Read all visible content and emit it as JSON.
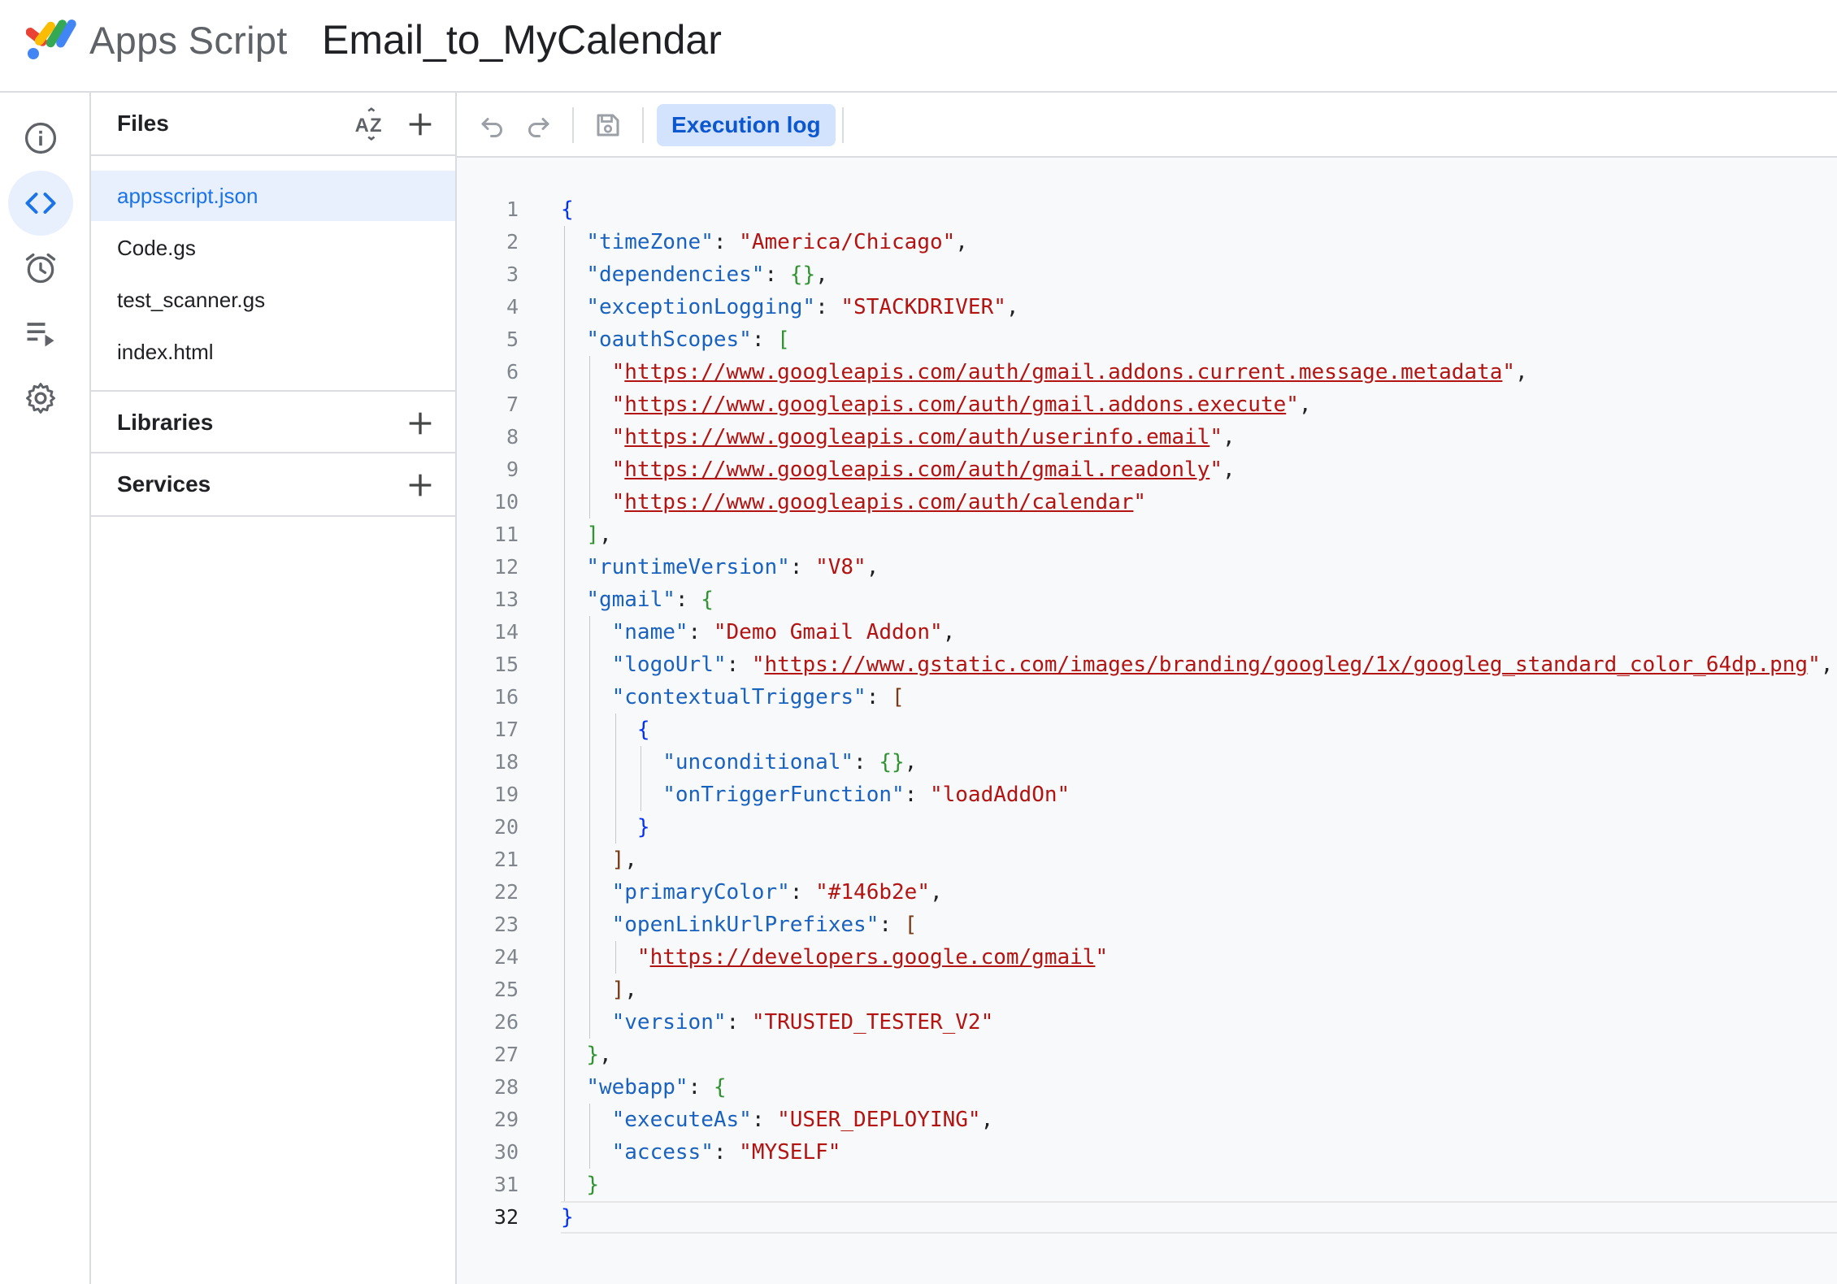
{
  "header": {
    "product_name": "Apps Script",
    "project_title": "Email_to_MyCalendar",
    "logo_icon": "apps-script-logo-icon"
  },
  "rail": {
    "items": [
      {
        "name": "overview",
        "icon": "info-icon",
        "active": false
      },
      {
        "name": "editor",
        "icon": "code-brackets-icon",
        "active": true
      },
      {
        "name": "triggers",
        "icon": "alarm-clock-icon",
        "active": false
      },
      {
        "name": "executions",
        "icon": "list-play-icon",
        "active": false
      },
      {
        "name": "settings",
        "icon": "gear-icon",
        "active": false
      }
    ]
  },
  "files_panel": {
    "files_label": "Files",
    "files": [
      "appsscript.json",
      "Code.gs",
      "test_scanner.gs",
      "index.html"
    ],
    "active_file": "appsscript.json",
    "libraries_label": "Libraries",
    "services_label": "Services"
  },
  "toolbar": {
    "execution_log_label": "Execution log"
  },
  "colors": {
    "accent": "#1a73e8",
    "active_bg": "#e8f0fe",
    "key": "#1a62c0",
    "string": "#b31412"
  },
  "editor": {
    "current_line": 32,
    "lines": [
      "{",
      "  \"timeZone\": \"America/Chicago\",",
      "  \"dependencies\": {},",
      "  \"exceptionLogging\": \"STACKDRIVER\",",
      "  \"oauthScopes\": [",
      "    \"https://www.googleapis.com/auth/gmail.addons.current.message.metadata\",",
      "    \"https://www.googleapis.com/auth/gmail.addons.execute\",",
      "    \"https://www.googleapis.com/auth/userinfo.email\",",
      "    \"https://www.googleapis.com/auth/gmail.readonly\",",
      "    \"https://www.googleapis.com/auth/calendar\"",
      "  ],",
      "  \"runtimeVersion\": \"V8\",",
      "  \"gmail\": {",
      "    \"name\": \"Demo Gmail Addon\",",
      "    \"logoUrl\": \"https://www.gstatic.com/images/branding/googleg/1x/googleg_standard_color_64dp.png\",",
      "    \"contextualTriggers\": [",
      "      {",
      "        \"unconditional\": {},",
      "        \"onTriggerFunction\": \"loadAddOn\"",
      "      }",
      "    ],",
      "    \"primaryColor\": \"#146b2e\",",
      "    \"openLinkUrlPrefixes\": [",
      "      \"https://developers.google.com/gmail\"",
      "    ],",
      "    \"version\": \"TRUSTED_TESTER_V2\"",
      "  },",
      "  \"webapp\": {",
      "    \"executeAs\": \"USER_DEPLOYING\",",
      "    \"access\": \"MYSELF\"",
      "  }",
      "}"
    ]
  }
}
